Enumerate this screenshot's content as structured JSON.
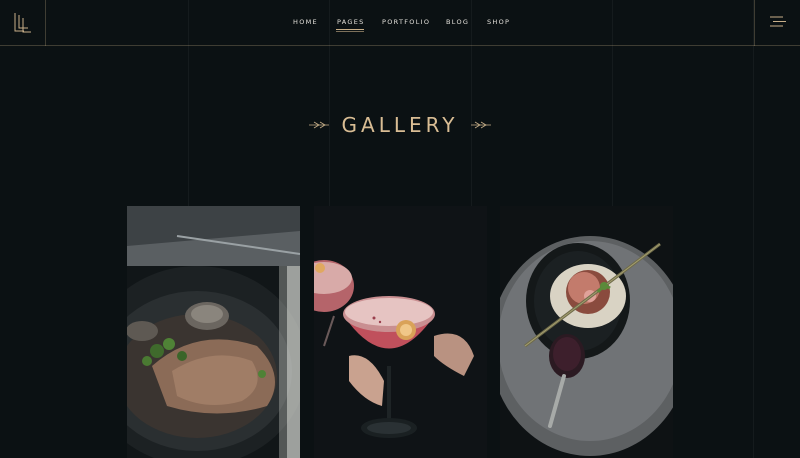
{
  "nav": {
    "items": [
      {
        "label": "HOME",
        "active": false
      },
      {
        "label": "PAGES",
        "active": true
      },
      {
        "label": "PORTFOLIO",
        "active": false
      },
      {
        "label": "BLOG",
        "active": false
      },
      {
        "label": "SHOP",
        "active": false
      }
    ]
  },
  "page": {
    "title": "GALLERY"
  },
  "gallery": {
    "items": [
      {
        "icon": "food-plate-photo"
      },
      {
        "icon": "cocktail-photo"
      },
      {
        "icon": "dessert-plate-photo"
      }
    ]
  },
  "colors": {
    "background": "#0b1113",
    "accent": "#c9b08a",
    "nav_text": "#e5e2dc"
  }
}
